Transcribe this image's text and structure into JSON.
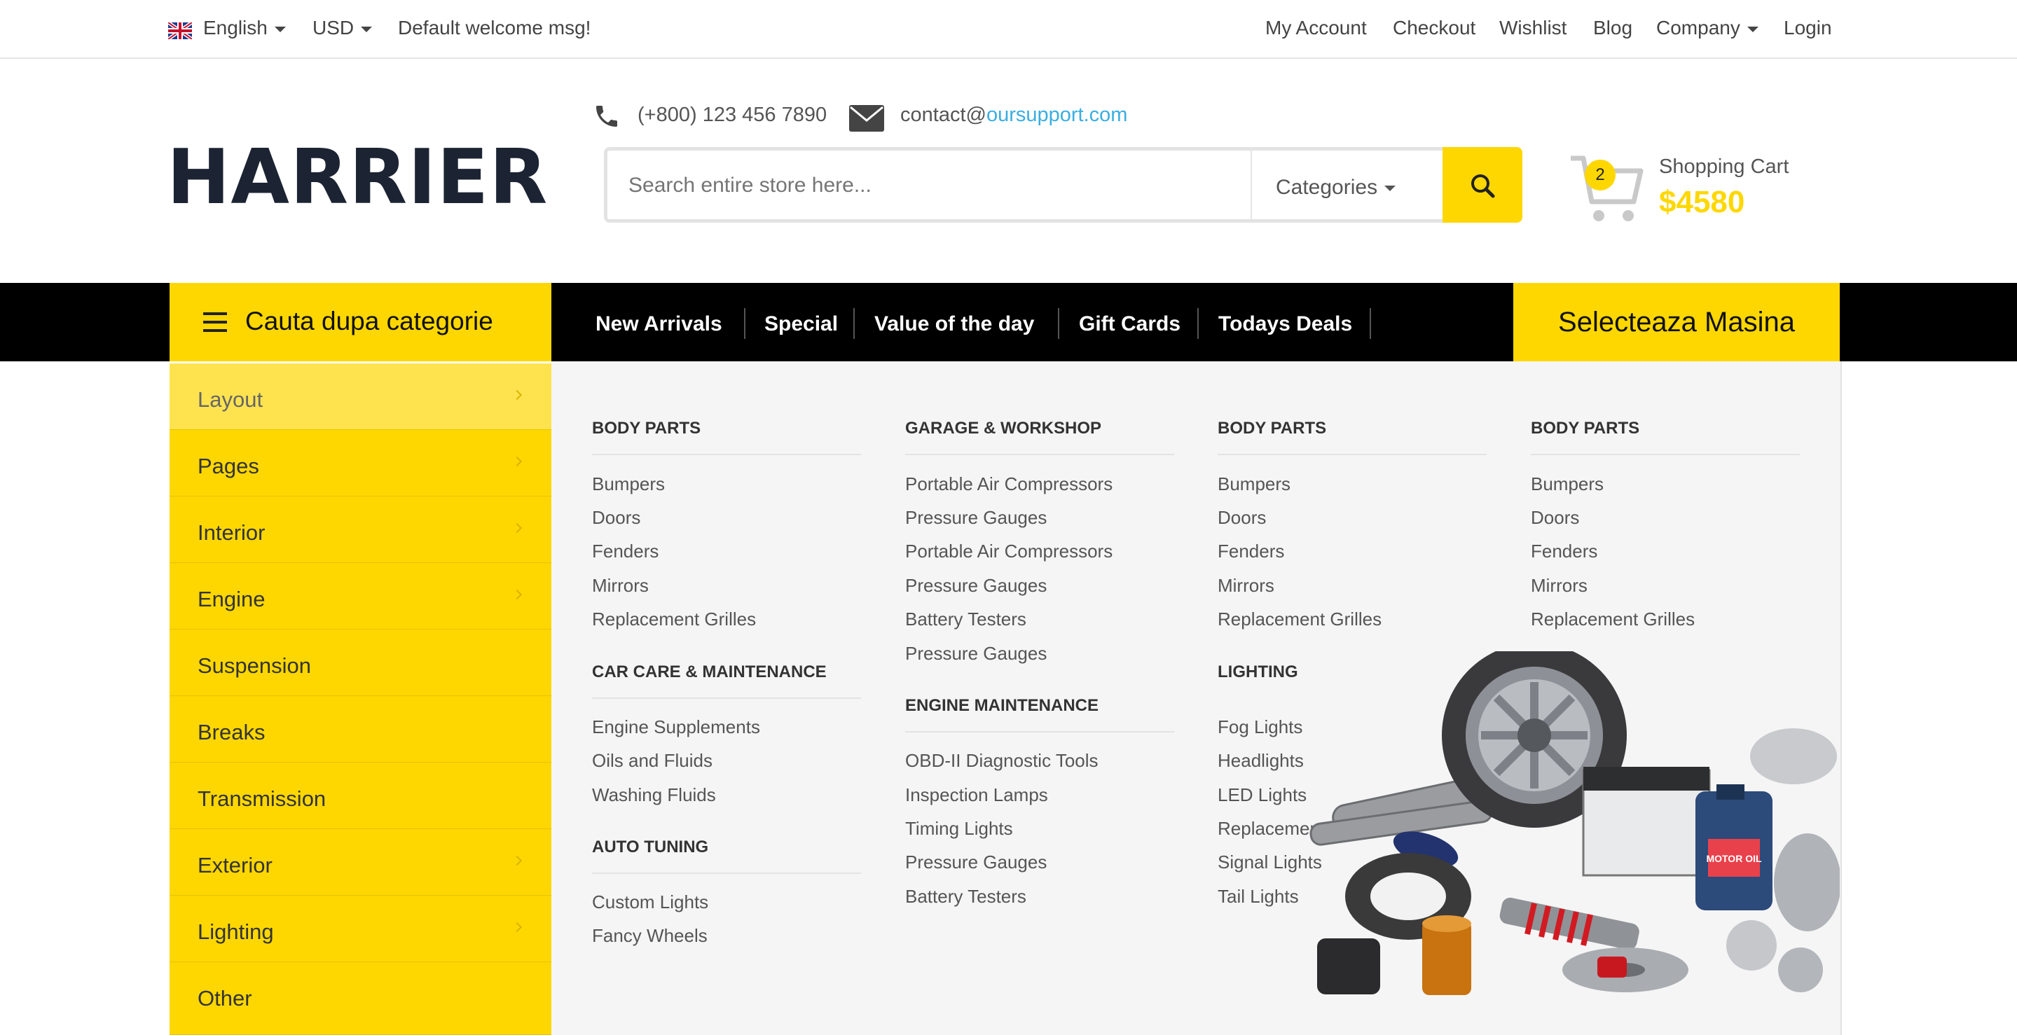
{
  "topbar": {
    "language": "English",
    "currency": "USD",
    "welcome": "Default welcome msg!",
    "links": [
      "My Account",
      "Checkout",
      "Wishlist",
      "Blog",
      "Company",
      "Login"
    ]
  },
  "header": {
    "logo": "HARRIER",
    "phone": "(+800) 123 456 7890",
    "email_prefix": "contact@",
    "email_domain": "oursupport.com",
    "search_placeholder": "Search entire store here...",
    "categories_label": "Categories",
    "cart_count": "2",
    "cart_label": "Shopping Cart",
    "cart_total": "$4580"
  },
  "nav": {
    "category_button": "Cauta dupa categorie",
    "items": [
      "New Arrivals",
      "Special",
      "Value of the day",
      "Gift Cards",
      "Todays Deals"
    ],
    "select_car": "Selecteaza Masina"
  },
  "sidebar": {
    "items": [
      "Layout",
      "Pages",
      "Interior",
      "Engine",
      "Suspension",
      "Breaks",
      "Transmission",
      "Exterior",
      "Lighting",
      "Other"
    ]
  },
  "mega": {
    "col1": {
      "h1": "BODY PARTS",
      "l1": [
        "Bumpers",
        "Doors",
        "Fenders",
        "Mirrors",
        "Replacement Grilles"
      ],
      "h2": "CAR CARE & MAINTENANCE",
      "l2": [
        "Engine Supplements",
        "Oils and Fluids",
        "Washing Fluids"
      ],
      "h3": "AUTO TUNING",
      "l3": [
        "Custom Lights",
        "Fancy Wheels"
      ]
    },
    "col2": {
      "h1": "GARAGE & WORKSHOP",
      "l1": [
        "Portable Air Compressors",
        "Pressure Gauges",
        "Portable Air Compressors",
        "Pressure Gauges",
        "Battery Testers",
        "Pressure Gauges"
      ],
      "h2": "ENGINE MAINTENANCE",
      "l2": [
        "OBD-II Diagnostic Tools",
        "Inspection Lamps",
        "Timing Lights",
        "Pressure Gauges",
        "Battery Testers"
      ]
    },
    "col3": {
      "h1": "BODY PARTS",
      "l1": [
        "Bumpers",
        "Doors",
        "Fenders",
        "Mirrors",
        "Replacement Grilles"
      ],
      "h2": "LIGHTING",
      "l2": [
        "Fog Lights",
        "Headlights",
        "LED Lights",
        "Replacement",
        "Signal Lights",
        "Tail Lights"
      ]
    },
    "col4": {
      "h1": "BODY PARTS",
      "l1": [
        "Bumpers",
        "Doors",
        "Fenders",
        "Mirrors",
        "Replacement Grilles"
      ]
    },
    "image_label": "MOTOR OIL"
  },
  "colors": {
    "accent": "#fed700",
    "link": "#3aaee0",
    "dark": "#000000"
  }
}
